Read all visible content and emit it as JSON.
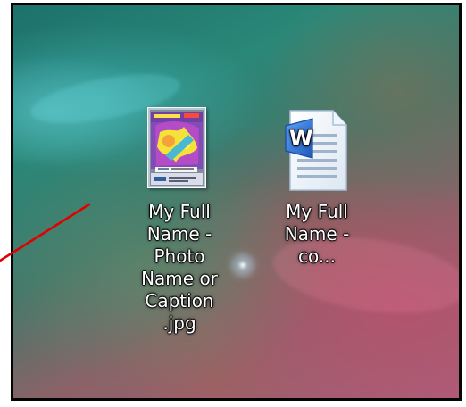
{
  "desktop": {
    "items": [
      {
        "label": "My Full Name - Photo Name or Caption .jpg",
        "icon": "image-thumbnail-icon"
      },
      {
        "label": "My Full Name - co...",
        "icon": "word-document-icon",
        "badge": "W"
      }
    ]
  },
  "colors": {
    "annotation_line": "#e00000",
    "frame": "#050505",
    "label_text": "#ffffff",
    "word_blue": "#1f57b8"
  }
}
